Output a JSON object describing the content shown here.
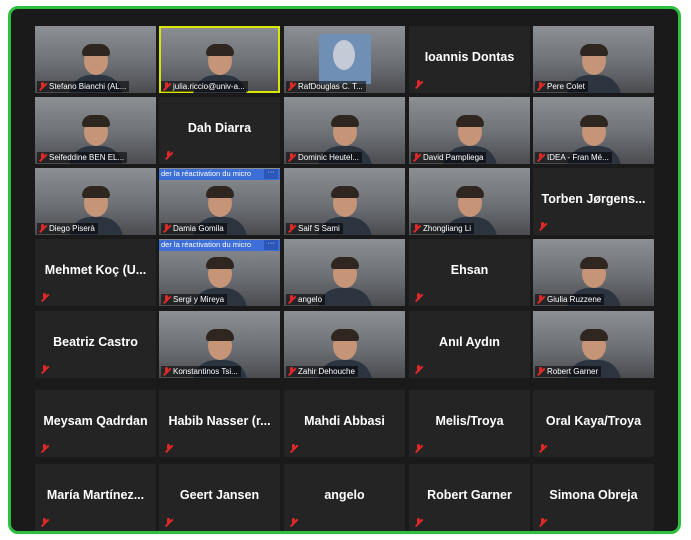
{
  "window": {
    "border_color": "#2fbf3f",
    "background": "#1a1a1a",
    "muted_icon": "mic-muted-icon"
  },
  "banner": {
    "text": "der la réactivation du micro",
    "more": "···"
  },
  "participants": [
    {
      "label": "Stefano Bianchi (AL...",
      "video": true
    },
    {
      "label": "julia.riccio@univ-a...",
      "video": true,
      "speaking": true
    },
    {
      "label": "RafDouglas C. T...",
      "video": true,
      "portrait": true
    },
    {
      "name": "Ioannis Dontas",
      "video": false
    },
    {
      "label": "Pere Colet",
      "video": true
    },
    {
      "label": "Seifeddine BEN EL...",
      "video": true
    },
    {
      "name": "Dah Diarra",
      "video": false
    },
    {
      "label": "Dominic Heutel...",
      "video": true
    },
    {
      "label": "David Pampliega",
      "video": true
    },
    {
      "label": "IDEA - Fran Mé...",
      "video": true
    },
    {
      "label": "Diego Piserà",
      "video": true
    },
    {
      "label": "Damia Gomila",
      "video": true,
      "banner": true
    },
    {
      "label": "Saif S Sami",
      "video": true
    },
    {
      "label": "Zhongliang Li",
      "video": true
    },
    {
      "name": "Torben Jørgens...",
      "video": false
    },
    {
      "name": "Mehmet Koç (U...",
      "video": false
    },
    {
      "label": "Sergi y Mireya",
      "video": true,
      "banner": true
    },
    {
      "label": "angelo",
      "video": true
    },
    {
      "name": "Ehsan",
      "video": false
    },
    {
      "label": "Giulia Ruzzene",
      "video": true
    },
    {
      "name": "Beatriz Castro",
      "video": false
    },
    {
      "label": "Konstantinos Tsi...",
      "video": true
    },
    {
      "label": "Zahir Dehouche",
      "video": true
    },
    {
      "name": "Anıl Aydın",
      "video": false
    },
    {
      "label": "Robert Garner",
      "video": true
    },
    {
      "name": "Meysam Qadrdan",
      "video": false
    },
    {
      "name": "Habib Nasser (r...",
      "video": false
    },
    {
      "name": "Mahdi Abbasi",
      "video": false
    },
    {
      "name": "Melis/Troya",
      "video": false
    },
    {
      "name": "Oral Kaya/Troya",
      "video": false
    },
    {
      "name": "María Martínez...",
      "video": false
    },
    {
      "name": "Geert Jansen",
      "video": false
    },
    {
      "name": "angelo",
      "video": false
    },
    {
      "name": "Robert Garner",
      "video": false
    },
    {
      "name": "Simona Obreja",
      "video": false
    }
  ]
}
